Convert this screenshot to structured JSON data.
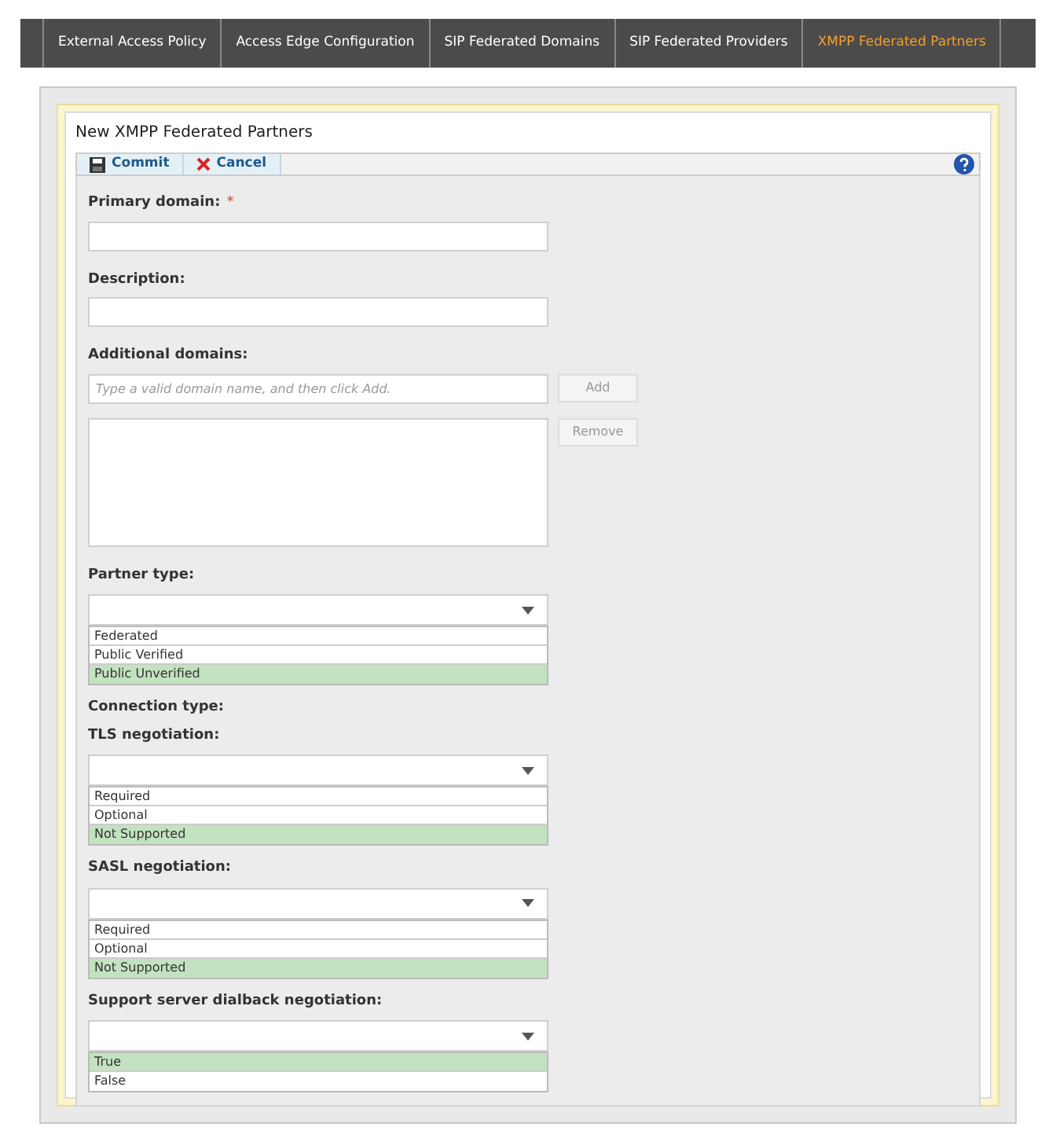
{
  "tabs": [
    {
      "label": "External Access Policy",
      "selected": false
    },
    {
      "label": "Access Edge Configuration",
      "selected": false
    },
    {
      "label": "SIP Federated Domains",
      "selected": false
    },
    {
      "label": "SIP Federated Providers",
      "selected": false
    },
    {
      "label": "XMPP Federated Partners",
      "selected": true
    }
  ],
  "dialog": {
    "title": "New XMPP Federated Partners",
    "toolbar": [
      {
        "kind": "commit",
        "label": "Commit"
      },
      {
        "kind": "cancel",
        "label": "Cancel"
      }
    ]
  },
  "fields": [
    {
      "kind": "text",
      "label": "Primary domain:",
      "mark": "*"
    },
    {
      "kind": "text",
      "label": "Description:"
    },
    {
      "kind": "domains",
      "label": "Additional domains:",
      "placeholder": "Type a valid domain name, and then click Add.",
      "add": "Add",
      "remove": "Remove"
    },
    {
      "kind": "select",
      "label": "Partner type:",
      "options": [
        {
          "label": "Federated",
          "selected": false
        },
        {
          "label": "Public Verified",
          "selected": false
        },
        {
          "label": "Public Unverified",
          "selected": true
        }
      ]
    },
    {
      "kind": "heading",
      "label": "Connection type:"
    },
    {
      "kind": "select",
      "label": "TLS negotiation:",
      "options": [
        {
          "label": "Required",
          "selected": false
        },
        {
          "label": "Optional",
          "selected": false
        },
        {
          "label": "Not Supported",
          "selected": true
        }
      ]
    },
    {
      "kind": "select",
      "label": "SASL negotiation:",
      "options": [
        {
          "label": "Required",
          "selected": false
        },
        {
          "label": "Optional",
          "selected": false
        },
        {
          "label": "Not Supported",
          "selected": true
        }
      ]
    },
    {
      "kind": "select",
      "label": "Support server dialback negotiation:",
      "options": [
        {
          "label": "True",
          "selected": true
        },
        {
          "label": "False",
          "selected": false
        }
      ]
    }
  ]
}
